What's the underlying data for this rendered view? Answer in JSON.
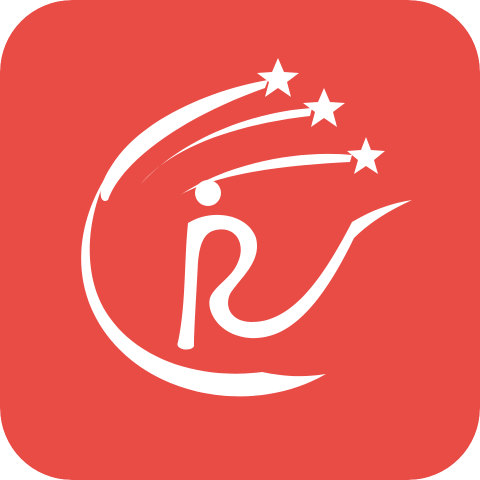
{
  "icon": {
    "name": "app-logo",
    "background_color": "#E94B45",
    "foreground_color": "#FFFFFF",
    "elements": [
      "star-icon",
      "star-icon",
      "star-icon",
      "comet-trail",
      "figure-head",
      "figure-body",
      "swoosh-arc"
    ]
  }
}
